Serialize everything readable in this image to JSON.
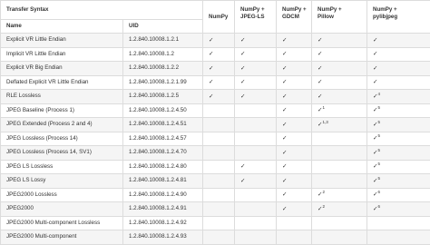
{
  "header": {
    "group_title": "Transfer Syntax",
    "name_label": "Name",
    "uid_label": "UID",
    "numpy": "NumPy",
    "jpegls": [
      "NumPy +",
      "JPEG-LS"
    ],
    "gdcm": [
      "NumPy +",
      "GDCM"
    ],
    "pillow": [
      "NumPy +",
      "Pillow"
    ],
    "pylibjpeg": [
      "NumPy +",
      "pylibjpeg"
    ]
  },
  "check_glyph": "✓",
  "rows": [
    {
      "name": "Explicit VR Little Endian",
      "uid": "1.2.840.10008.1.2.1",
      "numpy": "✓",
      "jpegls": "✓",
      "gdcm": "✓",
      "pillow": "✓",
      "pillow_note": "",
      "pylibjpeg": "✓",
      "pylibjpeg_note": ""
    },
    {
      "name": "Implicit VR Little Endian",
      "uid": "1.2.840.10008.1.2",
      "numpy": "✓",
      "jpegls": "✓",
      "gdcm": "✓",
      "pillow": "✓",
      "pillow_note": "",
      "pylibjpeg": "✓",
      "pylibjpeg_note": ""
    },
    {
      "name": "Explicit VR Big Endian",
      "uid": "1.2.840.10008.1.2.2",
      "numpy": "✓",
      "jpegls": "✓",
      "gdcm": "✓",
      "pillow": "✓",
      "pillow_note": "",
      "pylibjpeg": "✓",
      "pylibjpeg_note": ""
    },
    {
      "name": "Deflated Explicit VR Little Endian",
      "uid": "1.2.840.10008.1.2.1.99",
      "numpy": "✓",
      "jpegls": "✓",
      "gdcm": "✓",
      "pillow": "✓",
      "pillow_note": "",
      "pylibjpeg": "✓",
      "pylibjpeg_note": ""
    },
    {
      "name": "RLE Lossless",
      "uid": "1.2.840.10008.1.2.5",
      "numpy": "✓",
      "jpegls": "✓",
      "gdcm": "✓",
      "pillow": "✓",
      "pillow_note": "",
      "pylibjpeg": "✓",
      "pylibjpeg_note": "4"
    },
    {
      "name": "JPEG Baseline (Process 1)",
      "uid": "1.2.840.10008.1.2.4.50",
      "numpy": "",
      "jpegls": "",
      "gdcm": "✓",
      "pillow": "✓",
      "pillow_note": "1",
      "pylibjpeg": "✓",
      "pylibjpeg_note": "5"
    },
    {
      "name": "JPEG Extended (Process 2 and 4)",
      "uid": "1.2.840.10008.1.2.4.51",
      "numpy": "",
      "jpegls": "",
      "gdcm": "✓",
      "pillow": "✓",
      "pillow_note": "1,3",
      "pylibjpeg": "✓",
      "pylibjpeg_note": "5"
    },
    {
      "name": "JPEG Lossless (Process 14)",
      "uid": "1.2.840.10008.1.2.4.57",
      "numpy": "",
      "jpegls": "",
      "gdcm": "✓",
      "pillow": "",
      "pillow_note": "",
      "pylibjpeg": "✓",
      "pylibjpeg_note": "5"
    },
    {
      "name": "JPEG Lossless (Process 14, SV1)",
      "uid": "1.2.840.10008.1.2.4.70",
      "numpy": "",
      "jpegls": "",
      "gdcm": "✓",
      "pillow": "",
      "pillow_note": "",
      "pylibjpeg": "✓",
      "pylibjpeg_note": "5"
    },
    {
      "name": "JPEG LS Lossless",
      "uid": "1.2.840.10008.1.2.4.80",
      "numpy": "",
      "jpegls": "✓",
      "gdcm": "✓",
      "pillow": "",
      "pillow_note": "",
      "pylibjpeg": "✓",
      "pylibjpeg_note": "5"
    },
    {
      "name": "JPEG LS Lossy",
      "uid": "1.2.840.10008.1.2.4.81",
      "numpy": "",
      "jpegls": "✓",
      "gdcm": "✓",
      "pillow": "",
      "pillow_note": "",
      "pylibjpeg": "✓",
      "pylibjpeg_note": "5"
    },
    {
      "name": "JPEG2000 Lossless",
      "uid": "1.2.840.10008.1.2.4.90",
      "numpy": "",
      "jpegls": "",
      "gdcm": "✓",
      "pillow": "✓",
      "pillow_note": "2",
      "pylibjpeg": "✓",
      "pylibjpeg_note": "6"
    },
    {
      "name": "JPEG2000",
      "uid": "1.2.840.10008.1.2.4.91",
      "numpy": "",
      "jpegls": "",
      "gdcm": "✓",
      "pillow": "✓",
      "pillow_note": "2",
      "pylibjpeg": "✓",
      "pylibjpeg_note": "6"
    },
    {
      "name": "JPEG2000 Multi-component Lossless",
      "uid": "1.2.840.10008.1.2.4.92",
      "numpy": "",
      "jpegls": "",
      "gdcm": "",
      "pillow": "",
      "pillow_note": "",
      "pylibjpeg": "",
      "pylibjpeg_note": ""
    },
    {
      "name": "JPEG2000 Multi-component",
      "uid": "1.2.840.10008.1.2.4.93",
      "numpy": "",
      "jpegls": "",
      "gdcm": "",
      "pillow": "",
      "pillow_note": "",
      "pylibjpeg": "",
      "pylibjpeg_note": ""
    }
  ]
}
